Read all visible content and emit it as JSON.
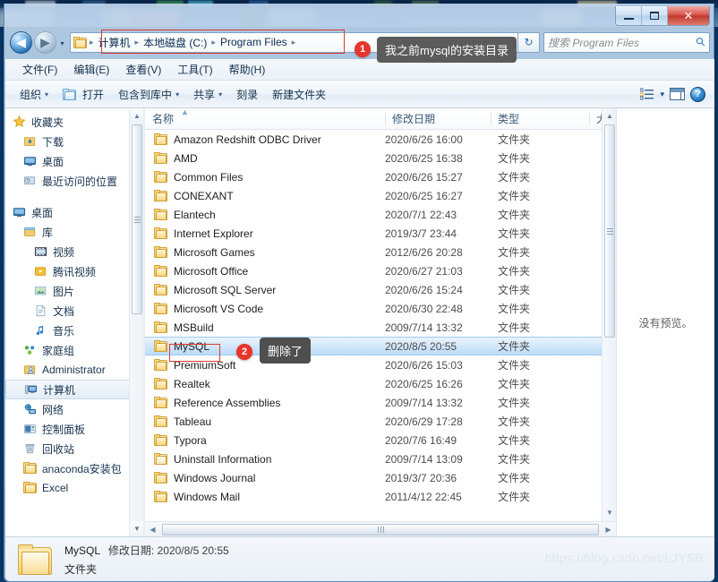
{
  "window": {
    "controls": {
      "minimize": "—",
      "maximize": "▫",
      "close": "✕"
    }
  },
  "address": {
    "back_icon": "back-arrow-icon",
    "forward_icon": "forward-arrow-icon",
    "history_caret": "▾",
    "crumbs": [
      "计算机",
      "本地磁盘 (C:)",
      "Program Files"
    ],
    "separator": "▸",
    "dropdown_caret": "▾",
    "refresh_icon": "↻"
  },
  "search": {
    "placeholder_label": "搜索",
    "placeholder_scope": "Program Files",
    "icon": "magnifier-icon"
  },
  "menu": {
    "items": [
      "文件(F)",
      "编辑(E)",
      "查看(V)",
      "工具(T)",
      "帮助(H)"
    ]
  },
  "toolbar": {
    "organize": "组织",
    "open": "打开",
    "include_in_library": "包含到库中",
    "share": "共享",
    "burn": "刻录",
    "new_folder": "新建文件夹",
    "caret": "▾",
    "view_icon": "view-list-icon",
    "preview_pane_icon": "preview-pane-icon",
    "help_icon": "?"
  },
  "sidebar": {
    "groups": [
      {
        "header": {
          "label": "收藏夹",
          "icon": "star-icon"
        },
        "items": [
          {
            "label": "下载",
            "icon": "downloads-icon",
            "indent": 1
          },
          {
            "label": "桌面",
            "icon": "desktop-icon",
            "indent": 1
          },
          {
            "label": "最近访问的位置",
            "icon": "recent-places-icon",
            "indent": 1
          }
        ]
      },
      {
        "header": {
          "label": "桌面",
          "icon": "desktop-icon"
        },
        "items": [
          {
            "label": "库",
            "icon": "library-icon",
            "indent": 1
          },
          {
            "label": "视频",
            "icon": "video-icon",
            "indent": 2
          },
          {
            "label": "腾讯视频",
            "icon": "tencent-video-icon",
            "indent": 2
          },
          {
            "label": "图片",
            "icon": "pictures-icon",
            "indent": 2
          },
          {
            "label": "文档",
            "icon": "documents-icon",
            "indent": 2
          },
          {
            "label": "音乐",
            "icon": "music-icon",
            "indent": 2
          },
          {
            "label": "家庭组",
            "icon": "homegroup-icon",
            "indent": 1
          },
          {
            "label": "Administrator",
            "icon": "user-icon",
            "indent": 1
          },
          {
            "label": "计算机",
            "icon": "computer-icon",
            "indent": 1,
            "selected": true
          },
          {
            "label": "网络",
            "icon": "network-icon",
            "indent": 1
          },
          {
            "label": "控制面板",
            "icon": "control-panel-icon",
            "indent": 1
          },
          {
            "label": "回收站",
            "icon": "recycle-bin-icon",
            "indent": 1
          },
          {
            "label": "anaconda安装包",
            "icon": "folder-icon",
            "indent": 1
          },
          {
            "label": "Excel",
            "icon": "folder-icon",
            "indent": 1
          }
        ]
      }
    ]
  },
  "filelist": {
    "columns": [
      "名称",
      "修改日期",
      "类型",
      "大"
    ],
    "sort_indicator": "▲",
    "rows": [
      {
        "name": "Amazon Redshift ODBC Driver",
        "date": "2020/6/26 16:00",
        "type": "文件夹"
      },
      {
        "name": "AMD",
        "date": "2020/6/25 16:38",
        "type": "文件夹"
      },
      {
        "name": "Common Files",
        "date": "2020/6/26 15:27",
        "type": "文件夹"
      },
      {
        "name": "CONEXANT",
        "date": "2020/6/25 16:27",
        "type": "文件夹"
      },
      {
        "name": "Elantech",
        "date": "2020/7/1 22:43",
        "type": "文件夹"
      },
      {
        "name": "Internet Explorer",
        "date": "2019/3/7 23:44",
        "type": "文件夹"
      },
      {
        "name": "Microsoft Games",
        "date": "2012/6/26 20:28",
        "type": "文件夹"
      },
      {
        "name": "Microsoft Office",
        "date": "2020/6/27 21:03",
        "type": "文件夹"
      },
      {
        "name": "Microsoft SQL Server",
        "date": "2020/6/26 15:24",
        "type": "文件夹"
      },
      {
        "name": "Microsoft VS Code",
        "date": "2020/6/30 22:48",
        "type": "文件夹"
      },
      {
        "name": "MSBuild",
        "date": "2009/7/14 13:32",
        "type": "文件夹"
      },
      {
        "name": "MySQL",
        "date": "2020/8/5 20:55",
        "type": "文件夹",
        "selected": true
      },
      {
        "name": "PremiumSoft",
        "date": "2020/6/26 15:03",
        "type": "文件夹"
      },
      {
        "name": "Realtek",
        "date": "2020/6/25 16:26",
        "type": "文件夹"
      },
      {
        "name": "Reference Assemblies",
        "date": "2009/7/14 13:32",
        "type": "文件夹"
      },
      {
        "name": "Tableau",
        "date": "2020/6/29 17:28",
        "type": "文件夹"
      },
      {
        "name": "Typora",
        "date": "2020/7/6 16:49",
        "type": "文件夹"
      },
      {
        "name": "Uninstall Information",
        "date": "2009/7/14 13:09",
        "type": "文件夹",
        "dim": true
      },
      {
        "name": "Windows Journal",
        "date": "2019/3/7 20:36",
        "type": "文件夹"
      },
      {
        "name": "Windows Mail",
        "date": "2011/4/12 22:45",
        "type": "文件夹"
      }
    ]
  },
  "preview": {
    "empty_text": "没有预览。"
  },
  "details": {
    "name": "MySQL",
    "modified_label": "修改日期:",
    "modified_value": "2020/8/5 20:55",
    "type": "文件夹"
  },
  "annotations": [
    {
      "badge": "1",
      "text": "我之前mysql的安装目录"
    },
    {
      "badge": "2",
      "text": "删除了"
    }
  ],
  "watermark": "https://blog.csdn.net/LJYSB",
  "colors": {
    "accent": "#e8342a",
    "selection": "#cfe6fa",
    "folder": "#f0c85d",
    "titlebar": "#bed4eb"
  }
}
